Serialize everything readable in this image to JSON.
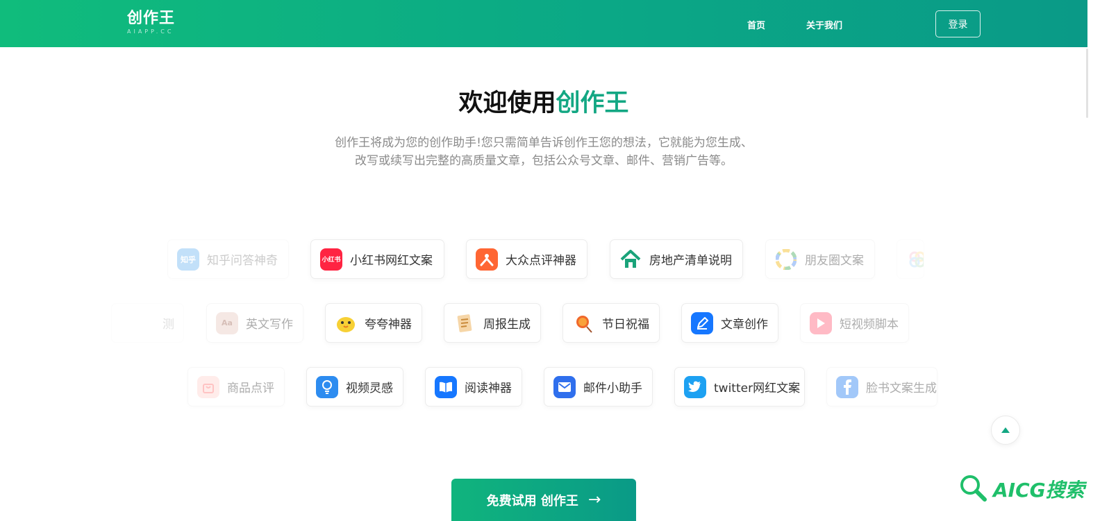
{
  "header": {
    "logo": "创作王",
    "logo_sub": "AIAPP.CC",
    "nav": [
      "首页",
      "关于我们"
    ],
    "login": "登录"
  },
  "hero": {
    "title_prefix": "欢迎使用",
    "title_accent": "创作王",
    "desc_line1": "创作王将成为您的创作助手!您只需简单告诉创作王您的想法，它就能为您生成、",
    "desc_line2": "改写或续写出完整的高质量文章，包括公众号文章、邮件、营销广告等。"
  },
  "tools": {
    "row1": [
      {
        "label": "知乎问答神奇",
        "icon": "zhihu-icon",
        "icon_text": "知乎",
        "color": "#0f88eb"
      },
      {
        "label": "小红书网红文案",
        "icon": "xiaohongshu-icon",
        "icon_text": "小红书",
        "color": "#ff2442"
      },
      {
        "label": "大众点评神器",
        "icon": "dianping-icon",
        "icon_text": "",
        "color": "#ff6633"
      },
      {
        "label": "房地产清单说明",
        "icon": "house-icon",
        "icon_text": "",
        "color": "#1aa37a"
      },
      {
        "label": "朋友圈文案",
        "icon": "moments-icon",
        "icon_text": "",
        "color": "#f4b400"
      },
      {
        "label": "",
        "icon": "clover-icon",
        "icon_text": "",
        "color": "#f06292"
      }
    ],
    "row2": [
      {
        "label": "测",
        "icon": "",
        "icon_text": "",
        "color": ""
      },
      {
        "label": "英文写作",
        "icon": "dictionary-icon",
        "icon_text": "Aa",
        "color": "#c98d7c"
      },
      {
        "label": "夸夸神器",
        "icon": "chick-icon",
        "icon_text": "",
        "color": "#f7d035"
      },
      {
        "label": "周报生成",
        "icon": "notepad-icon",
        "icon_text": "",
        "color": "#e9a34a"
      },
      {
        "label": "节日祝福",
        "icon": "lantern-icon",
        "icon_text": "",
        "color": "#f0682b"
      },
      {
        "label": "文章创作",
        "icon": "pen-icon",
        "icon_text": "",
        "color": "#1677ff"
      },
      {
        "label": "短视频脚本",
        "icon": "play-icon",
        "icon_text": "",
        "color": "#ff5570"
      }
    ],
    "row3": [
      {
        "label": "商品点评",
        "icon": "shopping-bag-icon",
        "icon_text": "",
        "color": "#ff6b6b"
      },
      {
        "label": "视频灵感",
        "icon": "bulb-icon",
        "icon_text": "",
        "color": "#2d8cf0"
      },
      {
        "label": "阅读神器",
        "icon": "book-icon",
        "icon_text": "",
        "color": "#1677ff"
      },
      {
        "label": "邮件小助手",
        "icon": "mail-icon",
        "icon_text": "",
        "color": "#2f6fed"
      },
      {
        "label": "twitter网红文案",
        "icon": "twitter-icon",
        "icon_text": "",
        "color": "#1da1f2"
      },
      {
        "label": "脸书文案生成",
        "icon": "facebook-icon",
        "icon_text": "",
        "color": "#1877f2"
      }
    ]
  },
  "cta": {
    "label": "免费试用 创作王",
    "arrow": "→"
  },
  "watermark": {
    "text": "AICG搜索"
  },
  "colors": {
    "brand": "#13a783",
    "nav_gradient_start": "#10bc7c",
    "nav_gradient_end": "#0a9a87"
  }
}
